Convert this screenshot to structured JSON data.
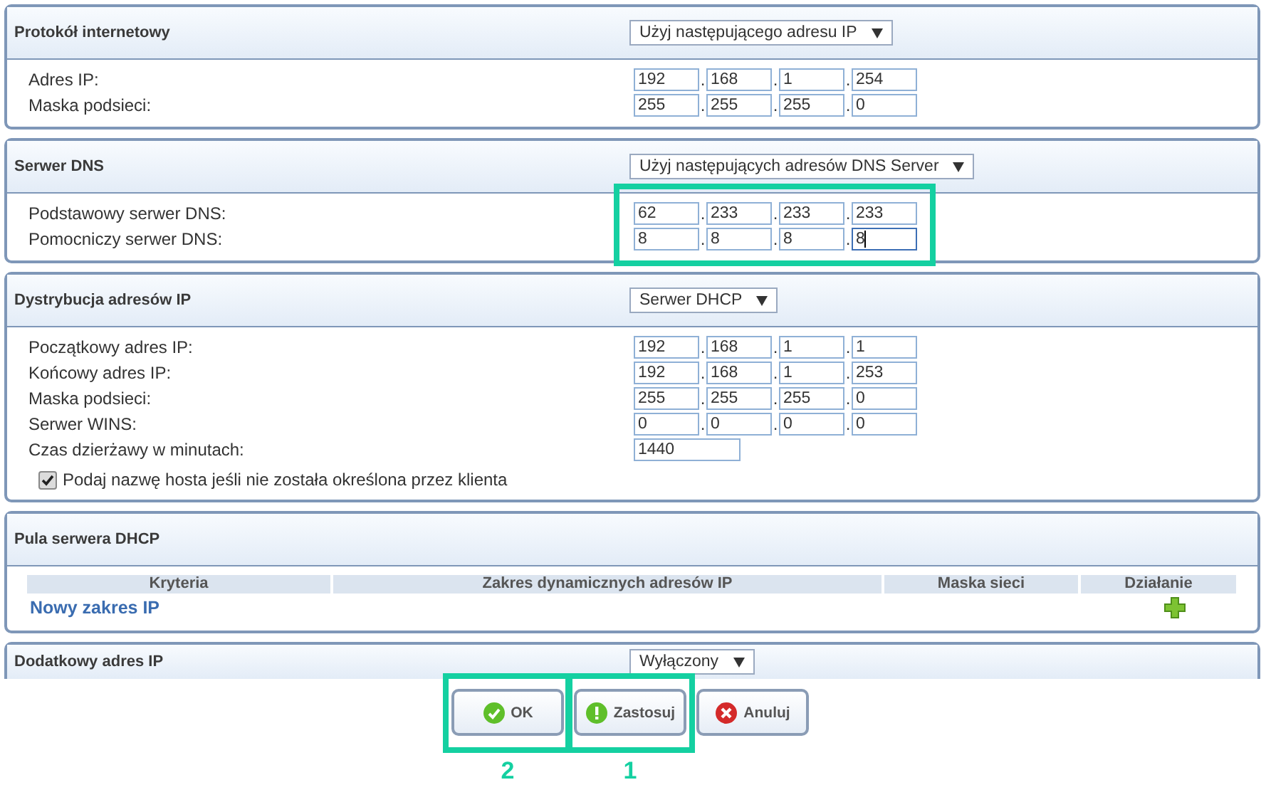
{
  "octet_separator": ".",
  "sections": [
    {
      "kind": "fields",
      "title": "Protokół internetowy",
      "select": "Użyj następującego adresu IP",
      "highlighted": false,
      "rows": [
        {
          "kind": "ip",
          "label": "Adres IP:",
          "octets": [
            {
              "value": "192",
              "focused": false
            },
            {
              "value": "168",
              "focused": false
            },
            {
              "value": "1",
              "focused": false
            },
            {
              "value": "254",
              "focused": false
            }
          ]
        },
        {
          "kind": "ip",
          "label": "Maska podsieci:",
          "octets": [
            {
              "value": "255",
              "focused": false
            },
            {
              "value": "255",
              "focused": false
            },
            {
              "value": "255",
              "focused": false
            },
            {
              "value": "0",
              "focused": false
            }
          ]
        }
      ]
    },
    {
      "kind": "fields",
      "title": "Serwer DNS",
      "select": "Użyj następujących adresów DNS Server",
      "highlighted": true,
      "rows": [
        {
          "kind": "ip",
          "label": "Podstawowy serwer DNS:",
          "octets": [
            {
              "value": "62",
              "focused": false
            },
            {
              "value": "233",
              "focused": false
            },
            {
              "value": "233",
              "focused": false
            },
            {
              "value": "233",
              "focused": false
            }
          ]
        },
        {
          "kind": "ip",
          "label": "Pomocniczy serwer DNS:",
          "octets": [
            {
              "value": "8",
              "focused": false
            },
            {
              "value": "8",
              "focused": false
            },
            {
              "value": "8",
              "focused": false
            },
            {
              "value": "8",
              "focused": true
            }
          ]
        }
      ]
    },
    {
      "kind": "fields",
      "title": "Dystrybucja adresów IP",
      "select": "Serwer DHCP",
      "highlighted": false,
      "rows": [
        {
          "kind": "ip",
          "label": "Początkowy adres IP:",
          "octets": [
            {
              "value": "192",
              "focused": false
            },
            {
              "value": "168",
              "focused": false
            },
            {
              "value": "1",
              "focused": false
            },
            {
              "value": "1",
              "focused": false
            }
          ]
        },
        {
          "kind": "ip",
          "label": "Końcowy adres IP:",
          "octets": [
            {
              "value": "192",
              "focused": false
            },
            {
              "value": "168",
              "focused": false
            },
            {
              "value": "1",
              "focused": false
            },
            {
              "value": "253",
              "focused": false
            }
          ]
        },
        {
          "kind": "ip",
          "label": "Maska podsieci:",
          "octets": [
            {
              "value": "255",
              "focused": false
            },
            {
              "value": "255",
              "focused": false
            },
            {
              "value": "255",
              "focused": false
            },
            {
              "value": "0",
              "focused": false
            }
          ]
        },
        {
          "kind": "ip",
          "label": "Serwer WINS:",
          "octets": [
            {
              "value": "0",
              "focused": false
            },
            {
              "value": "0",
              "focused": false
            },
            {
              "value": "0",
              "focused": false
            },
            {
              "value": "0",
              "focused": false
            }
          ]
        },
        {
          "kind": "text",
          "label": "Czas dzierżawy w minutach:",
          "value": "1440"
        }
      ],
      "checkbox": {
        "label": "Podaj nazwę hosta jeśli nie została określona przez klienta",
        "checked": true
      }
    },
    {
      "kind": "table",
      "title": "Pula serwera DHCP",
      "table": {
        "columns": [
          "Kryteria",
          "Zakres dynamicznych adresów IP",
          "Maska sieci",
          "Działanie"
        ],
        "link": "Nowy zakres IP"
      }
    },
    {
      "kind": "cut",
      "title": "Dodatkowy adres IP",
      "select": "Wyłączony"
    }
  ],
  "buttons": [
    {
      "kind": "ok",
      "label": "OK",
      "highlighted": true,
      "callout": "2"
    },
    {
      "kind": "apply",
      "label": "Zastosuj",
      "highlighted": true,
      "callout": "1"
    },
    {
      "kind": "cancel",
      "label": "Anuluj",
      "highlighted": false
    }
  ]
}
